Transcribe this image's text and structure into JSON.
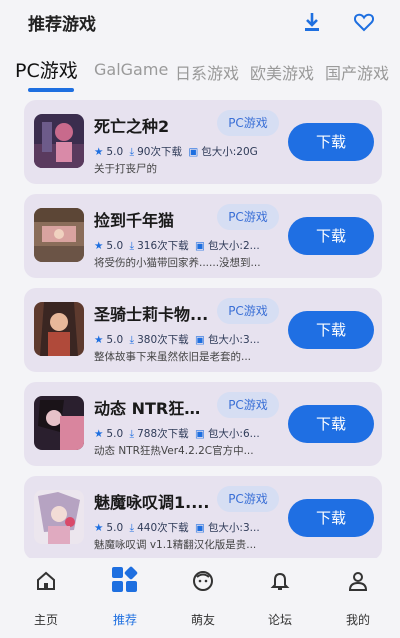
{
  "header": {
    "title": "推荐游戏",
    "download_icon": "download-icon",
    "favorite_icon": "heart-icon",
    "accent": "#1e6fe0"
  },
  "tabs": [
    {
      "label": "PC游戏",
      "active": true
    },
    {
      "label": "GalGame"
    },
    {
      "label": "日系游戏"
    },
    {
      "label": "欧美游戏"
    },
    {
      "label": "国产游戏"
    }
  ],
  "games": [
    {
      "name": "死亡之种2",
      "tag": "PC游戏",
      "rating": "5.0",
      "downloads": "90次下载",
      "size": "包大小:20G",
      "desc": "关于打丧尸的",
      "button": "下载"
    },
    {
      "name": "捡到千年猫",
      "tag": "PC游戏",
      "rating": "5.0",
      "downloads": "316次下载",
      "size": "包大小:2...",
      "desc": "将受伤的小猫带回家养......没想到...",
      "button": "下载"
    },
    {
      "name": "圣骑士莉卡物...",
      "tag": "PC游戏",
      "rating": "5.0",
      "downloads": "380次下载",
      "size": "包大小:3...",
      "desc": "整体故事下来虽然依旧是老套的...",
      "button": "下载"
    },
    {
      "name": "动态 NTR狂热...",
      "tag": "PC游戏",
      "rating": "5.0",
      "downloads": "788次下载",
      "size": "包大小:6...",
      "desc": "动态 NTR狂热Ver4.2.2C官方中...",
      "button": "下载"
    },
    {
      "name": "魅魔咏叹调1....",
      "tag": "PC游戏",
      "rating": "5.0",
      "downloads": "440次下载",
      "size": "包大小:3...",
      "desc": "魅魔咏叹调 v1.1精翻汉化版是贵...",
      "button": "下载"
    }
  ],
  "nav": [
    {
      "label": "主页",
      "icon": "home-icon"
    },
    {
      "label": "推荐",
      "icon": "grid-icon",
      "active": true
    },
    {
      "label": "萌友",
      "icon": "face-icon"
    },
    {
      "label": "论坛",
      "icon": "bell-icon"
    },
    {
      "label": "我的",
      "icon": "user-icon"
    }
  ]
}
